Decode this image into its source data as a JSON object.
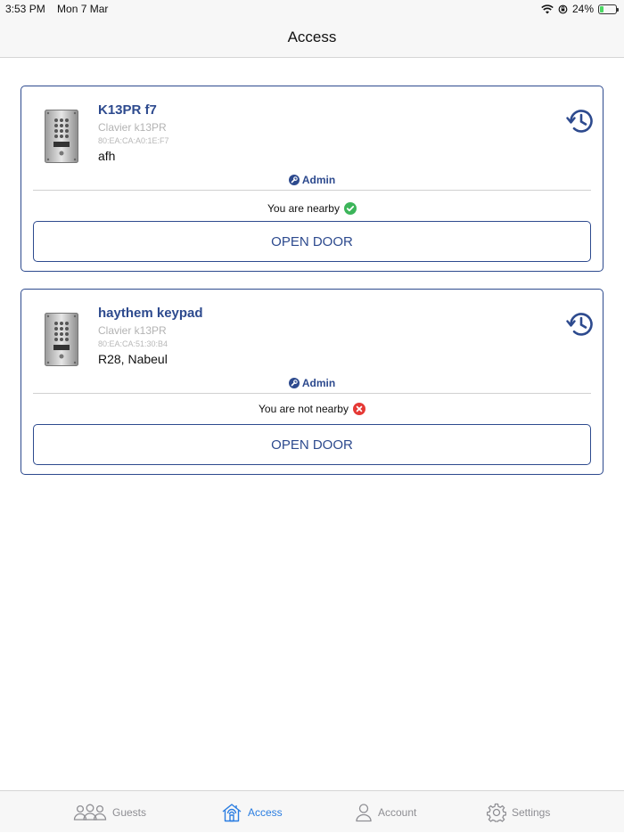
{
  "status_bar": {
    "time": "3:53 PM",
    "date": "Mon 7 Mar",
    "battery": "24%",
    "battery_level": 0.24
  },
  "nav": {
    "title": "Access"
  },
  "devices": [
    {
      "name": "K13PR f7",
      "model": "Clavier k13PR",
      "mac": "80:EA:CA:A0:1E:F7",
      "location": "afh",
      "role": "Admin",
      "proximity": "You are nearby",
      "nearby": true,
      "button": "OPEN DOOR"
    },
    {
      "name": "haythem keypad",
      "model": "Clavier k13PR",
      "mac": "80:EA:CA:51:30:B4",
      "location": "R28, Nabeul",
      "role": "Admin",
      "proximity": "You are not nearby",
      "nearby": false,
      "button": "OPEN DOOR"
    }
  ],
  "tabs": [
    {
      "label": "Guests",
      "icon": "guests-icon",
      "active": false
    },
    {
      "label": "Access",
      "icon": "home-access-icon",
      "active": true
    },
    {
      "label": "Account",
      "icon": "person-icon",
      "active": false
    },
    {
      "label": "Settings",
      "icon": "gear-icon",
      "active": false
    }
  ],
  "colors": {
    "accent": "#2d4a8e",
    "tab_active": "#2a7de1",
    "nearby_ok": "#3cb55a",
    "nearby_no": "#e53935"
  }
}
